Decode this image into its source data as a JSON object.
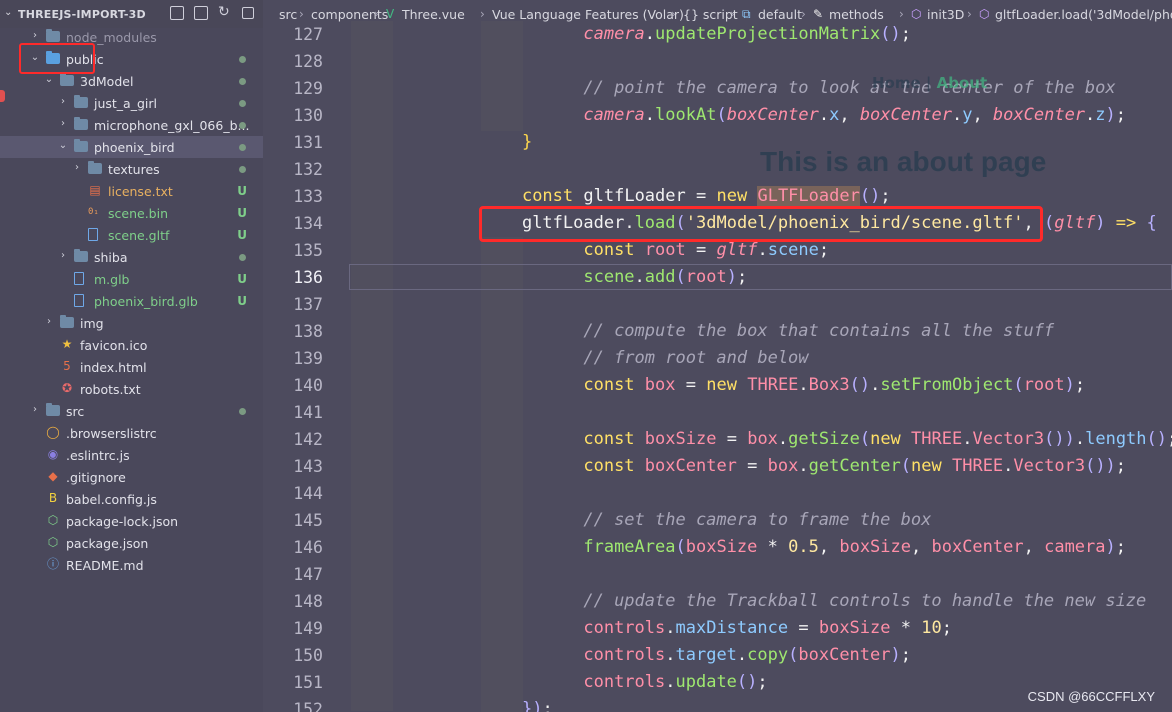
{
  "explorer": {
    "title": "THREEJS-IMPORT-3D",
    "items": [
      {
        "label": "node_modules",
        "type": "folder",
        "depth": 1,
        "status": ""
      },
      {
        "label": "public",
        "type": "folder-public",
        "depth": 1,
        "status": "dot"
      },
      {
        "label": "3dModel",
        "type": "folder",
        "depth": 2,
        "status": "dot"
      },
      {
        "label": "just_a_girl",
        "type": "folder",
        "depth": 3,
        "status": "dot"
      },
      {
        "label": "microphone_gxl_066_b...",
        "type": "folder",
        "depth": 3,
        "status": "dot"
      },
      {
        "label": "phoenix_bird",
        "type": "folder",
        "depth": 3,
        "status": "dot"
      },
      {
        "label": "textures",
        "type": "folder",
        "depth": 4,
        "status": "dot"
      },
      {
        "label": "license.txt",
        "type": "license",
        "depth": 4,
        "status": "U"
      },
      {
        "label": "scene.bin",
        "type": "bin",
        "depth": 4,
        "status": "U"
      },
      {
        "label": "scene.gltf",
        "type": "file",
        "depth": 4,
        "status": "U"
      },
      {
        "label": "shiba",
        "type": "folder",
        "depth": 3,
        "status": "dot"
      },
      {
        "label": "m.glb",
        "type": "file",
        "depth": 3,
        "status": "U"
      },
      {
        "label": "phoenix_bird.glb",
        "type": "file",
        "depth": 3,
        "status": "U"
      },
      {
        "label": "img",
        "type": "folder-img",
        "depth": 2,
        "status": ""
      },
      {
        "label": "favicon.ico",
        "type": "star",
        "depth": 2,
        "status": ""
      },
      {
        "label": "index.html",
        "type": "html",
        "depth": 2,
        "status": ""
      },
      {
        "label": "robots.txt",
        "type": "robot",
        "depth": 2,
        "status": ""
      },
      {
        "label": "src",
        "type": "folder-src",
        "depth": 1,
        "status": "dot"
      },
      {
        "label": ".browserslistrc",
        "type": "browsers",
        "depth": 1,
        "status": ""
      },
      {
        "label": ".eslintrc.js",
        "type": "eslint",
        "depth": 1,
        "status": ""
      },
      {
        "label": ".gitignore",
        "type": "git",
        "depth": 1,
        "status": ""
      },
      {
        "label": "babel.config.js",
        "type": "babel",
        "depth": 1,
        "status": ""
      },
      {
        "label": "package-lock.json",
        "type": "pkg",
        "depth": 1,
        "status": ""
      },
      {
        "label": "package.json",
        "type": "pkg",
        "depth": 1,
        "status": ""
      },
      {
        "label": "README.md",
        "type": "info",
        "depth": 1,
        "status": ""
      }
    ]
  },
  "breadcrumb": [
    "src",
    "components",
    "Three.vue",
    "Vue Language Features (Volar)",
    "{} script",
    "default",
    "methods",
    "init3D",
    "gltfLoader.load('3dModel/pho"
  ],
  "overlay": {
    "nav_home": "Home",
    "nav_sep": "|",
    "nav_about": "About",
    "heading": "This is an about page"
  },
  "watermark": "CSDN @66CCFFLXY",
  "current_line": 136,
  "line_numbers": [
    127,
    128,
    129,
    130,
    131,
    132,
    133,
    134,
    135,
    136,
    137,
    138,
    139,
    140,
    141,
    142,
    143,
    144,
    145,
    146,
    147,
    148,
    149,
    150,
    151,
    152
  ],
  "colors": {
    "highlight_box": "#ff2a2a",
    "editor_bg": "#4d4b5e",
    "sidebar_bg": "#4a485b"
  }
}
